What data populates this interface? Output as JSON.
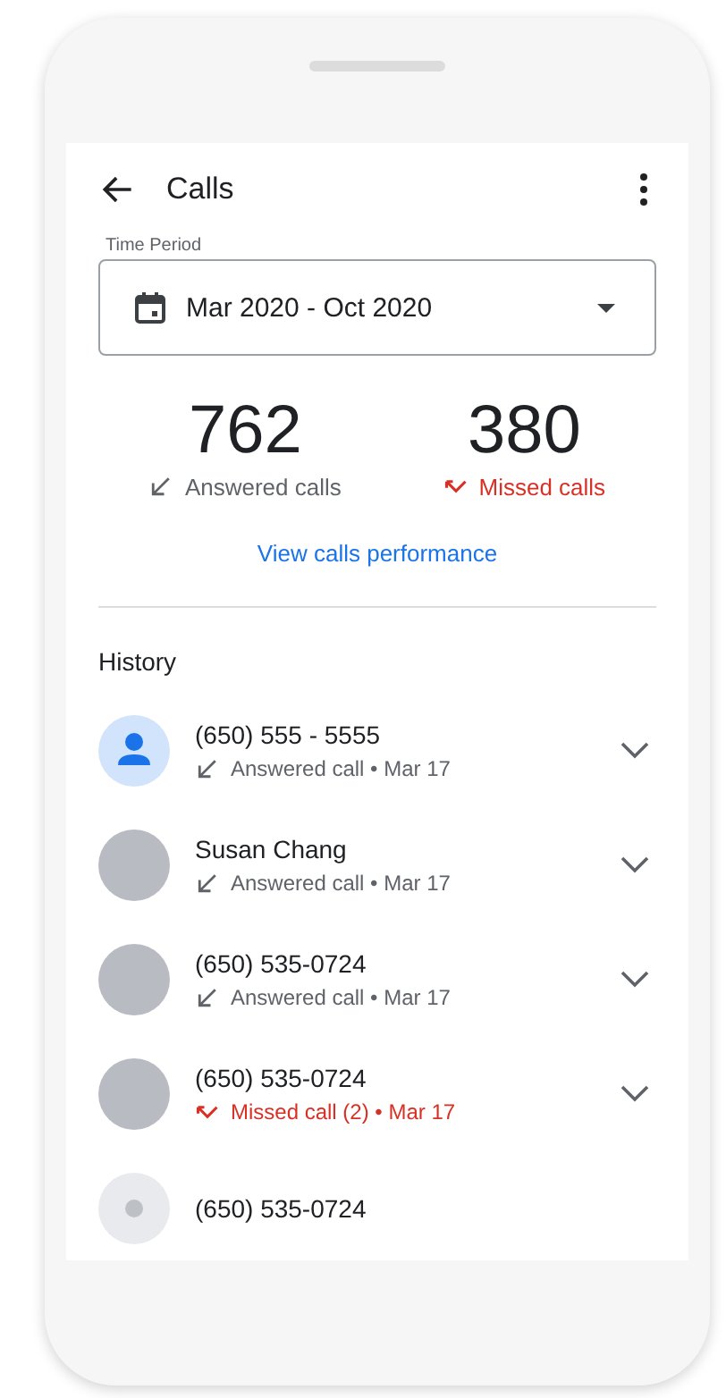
{
  "app_bar": {
    "title": "Calls"
  },
  "time_period": {
    "label": "Time Period",
    "value": "Mar 2020 - Oct 2020"
  },
  "stats": [
    {
      "kind": "answered",
      "count": "762",
      "label": "Answered calls"
    },
    {
      "kind": "missed",
      "count": "380",
      "label": "Missed calls"
    }
  ],
  "performance_link": "View calls performance",
  "history": {
    "title": "History",
    "items": [
      {
        "name": "(650) 555 - 5555",
        "avatar": {
          "kind": "generic"
        },
        "call": {
          "kind": "answered",
          "text": "Answered call • Mar 17"
        }
      },
      {
        "name": "Susan Chang",
        "avatar": {
          "kind": "photo"
        },
        "call": {
          "kind": "answered",
          "text": "Answered call • Mar 17"
        }
      },
      {
        "name": "(650) 535-0724",
        "avatar": {
          "kind": "photo"
        },
        "call": {
          "kind": "answered",
          "text": "Answered call • Mar 17"
        }
      },
      {
        "name": "(650) 535-0724",
        "avatar": {
          "kind": "photo"
        },
        "call": {
          "kind": "missed",
          "text": "Missed call (2) • Mar 17"
        }
      },
      {
        "name": "(650) 535-0724",
        "avatar": {
          "kind": "placeholder"
        }
      }
    ]
  }
}
